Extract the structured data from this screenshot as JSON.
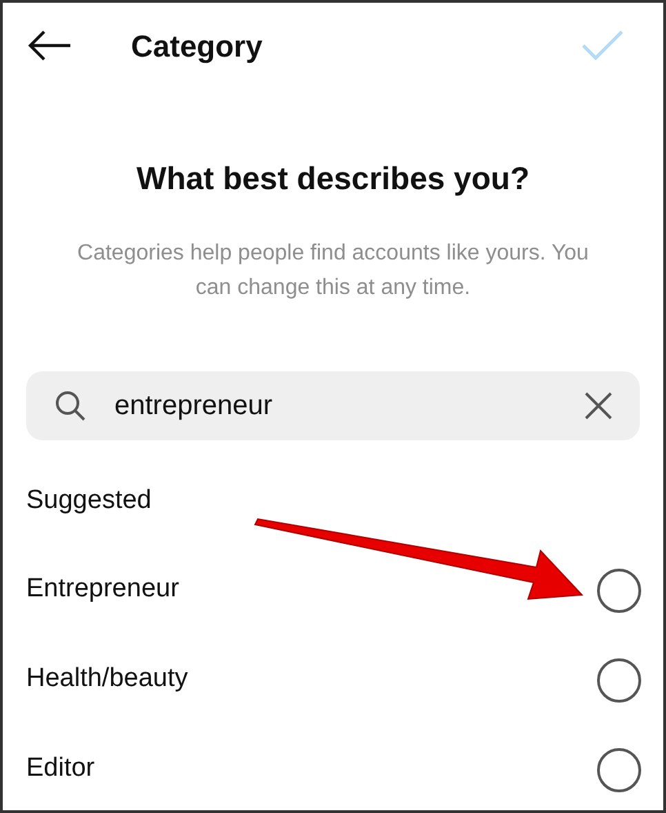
{
  "header": {
    "title": "Category"
  },
  "heading": "What best describes you?",
  "description": "Categories help people find accounts like yours. You can change this at any time.",
  "search": {
    "value": "entrepreneur"
  },
  "section_title": "Suggested",
  "options": [
    {
      "label": "Entrepreneur",
      "selected": false
    },
    {
      "label": "Health/beauty",
      "selected": false
    },
    {
      "label": "Editor",
      "selected": false
    }
  ]
}
